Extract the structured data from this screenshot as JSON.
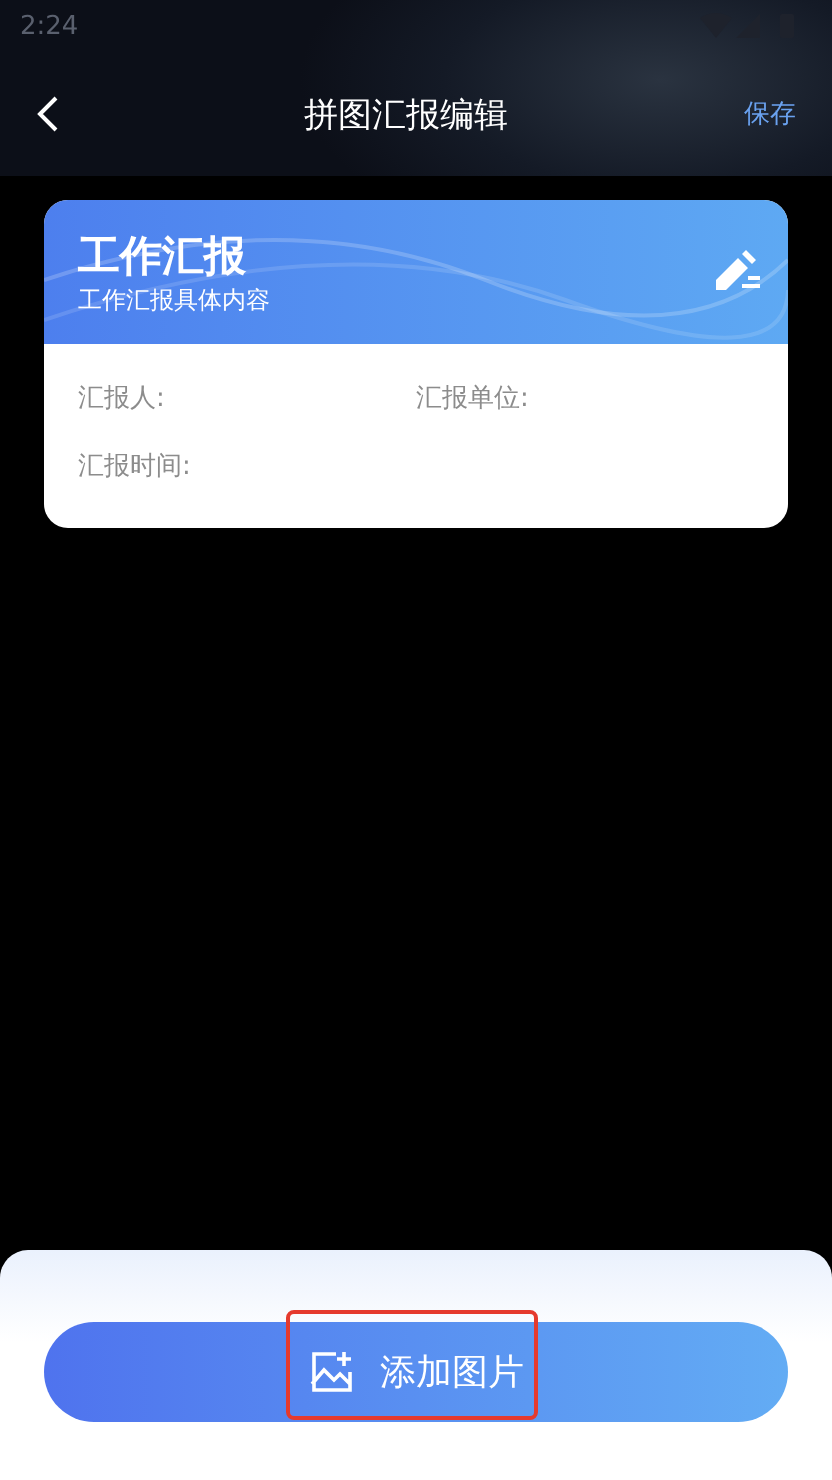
{
  "status_bar": {
    "time": "2:24"
  },
  "header": {
    "title": "拼图汇报编辑",
    "save": "保存"
  },
  "card": {
    "title": "工作汇报",
    "subtitle": "工作汇报具体内容",
    "fields": [
      {
        "label": "汇报人:"
      },
      {
        "label": "汇报单位:"
      },
      {
        "label": "汇报时间:"
      }
    ]
  },
  "add_button": {
    "label": "添加图片",
    "highlighted": true
  }
}
